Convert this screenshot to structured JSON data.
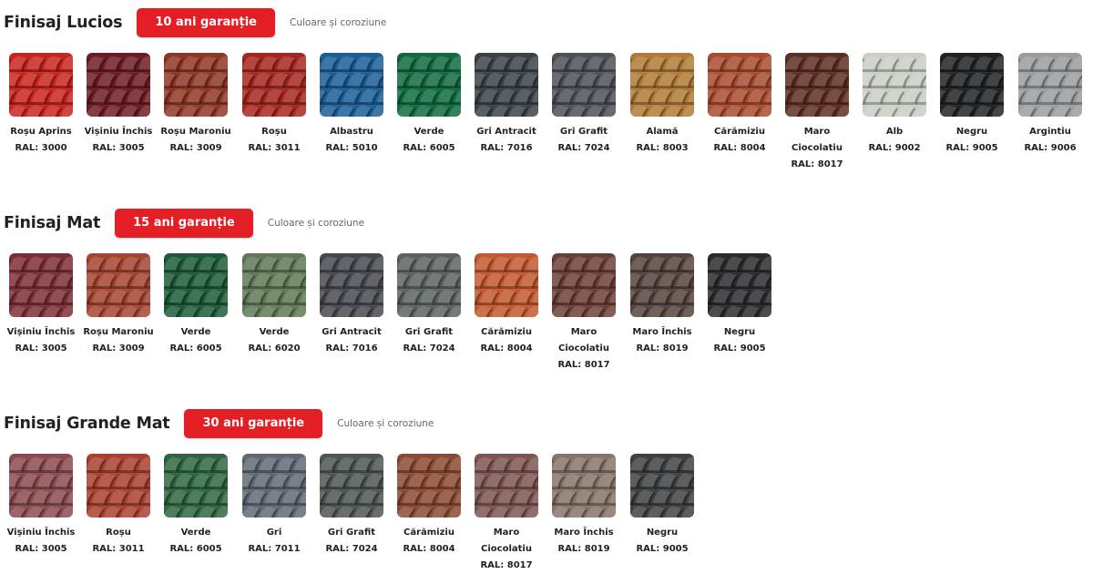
{
  "sections": [
    {
      "title": "Finisaj Lucios",
      "badge": "10 ani garanție",
      "subtitle": "Culoare și coroziune",
      "colors": [
        {
          "name": "Roșu Aprins",
          "ral": "RAL: 3000",
          "hex": "#c8231e",
          "icon": "roof-tile-swatch"
        },
        {
          "name": "Vișiniu Închis",
          "ral": "RAL: 3005",
          "hex": "#6d1a24",
          "icon": "roof-tile-swatch"
        },
        {
          "name": "Roșu Maroniu",
          "ral": "RAL: 3009",
          "hex": "#8e3524",
          "icon": "roof-tile-swatch"
        },
        {
          "name": "Roșu",
          "ral": "RAL: 3011",
          "hex": "#a5261e",
          "icon": "roof-tile-swatch"
        },
        {
          "name": "Albastru",
          "ral": "RAL: 5010",
          "hex": "#1b5d96",
          "icon": "roof-tile-swatch"
        },
        {
          "name": "Verde",
          "ral": "RAL: 6005",
          "hex": "#0f6a40",
          "icon": "roof-tile-swatch"
        },
        {
          "name": "Gri Antracit",
          "ral": "RAL: 7016",
          "hex": "#3b4146",
          "icon": "roof-tile-swatch"
        },
        {
          "name": "Gri Grafit",
          "ral": "RAL: 7024",
          "hex": "#4d5155",
          "icon": "roof-tile-swatch"
        },
        {
          "name": "Alamă",
          "ral": "RAL: 8003",
          "hex": "#b07a36",
          "icon": "roof-tile-swatch"
        },
        {
          "name": "Cărămiziu",
          "ral": "RAL: 8004",
          "hex": "#a84b2e",
          "icon": "roof-tile-swatch"
        },
        {
          "name": "Maro Ciocolatiu",
          "ral": "RAL: 8017",
          "hex": "#5c2d22",
          "icon": "roof-tile-swatch"
        },
        {
          "name": "Alb",
          "ral": "RAL: 9002",
          "hex": "#c9cdc6",
          "icon": "roof-tile-swatch"
        },
        {
          "name": "Negru",
          "ral": "RAL: 9005",
          "hex": "#202224",
          "icon": "roof-tile-swatch"
        },
        {
          "name": "Argintiu",
          "ral": "RAL: 9006",
          "hex": "#9a9c9e",
          "icon": "roof-tile-swatch"
        }
      ]
    },
    {
      "title": "Finisaj Mat",
      "badge": "15 ani garanție",
      "subtitle": "Culoare și coroziune",
      "colors": [
        {
          "name": "Vișiniu Închis",
          "ral": "RAL: 3005",
          "hex": "#7a2f35",
          "icon": "roof-tile-swatch"
        },
        {
          "name": "Roșu Maroniu",
          "ral": "RAL: 3009",
          "hex": "#a44431",
          "icon": "roof-tile-swatch"
        },
        {
          "name": "Verde",
          "ral": "RAL: 6005",
          "hex": "#1d5a37",
          "icon": "roof-tile-swatch"
        },
        {
          "name": "Verde",
          "ral": "RAL: 6020",
          "hex": "#5f7856",
          "icon": "roof-tile-swatch"
        },
        {
          "name": "Gri Antracit",
          "ral": "RAL: 7016",
          "hex": "#45494f",
          "icon": "roof-tile-swatch"
        },
        {
          "name": "Gri Grafit",
          "ral": "RAL: 7024",
          "hex": "#5d6261",
          "icon": "roof-tile-swatch"
        },
        {
          "name": "Cărămiziu",
          "ral": "RAL: 8004",
          "hex": "#c2582f",
          "icon": "roof-tile-swatch"
        },
        {
          "name": "Maro Ciocolatiu",
          "ral": "RAL: 8017",
          "hex": "#6b3e35",
          "icon": "roof-tile-swatch"
        },
        {
          "name": "Maro Închis",
          "ral": "RAL: 8019",
          "hex": "#55433d",
          "icon": "roof-tile-swatch"
        },
        {
          "name": "Negru",
          "ral": "RAL: 9005",
          "hex": "#2a2b2d",
          "icon": "roof-tile-swatch"
        }
      ]
    },
    {
      "title": "Finisaj Grande Mat",
      "badge": "30 ani garanție",
      "subtitle": "Culoare și coroziune",
      "colors": [
        {
          "name": "Vișiniu Închis",
          "ral": "RAL: 3005",
          "hex": "#8a4a4f",
          "icon": "roof-tile-swatch"
        },
        {
          "name": "Roșu",
          "ral": "RAL: 3011",
          "hex": "#a8402f",
          "icon": "roof-tile-swatch"
        },
        {
          "name": "Verde",
          "ral": "RAL: 6005",
          "hex": "#2e6540",
          "icon": "roof-tile-swatch"
        },
        {
          "name": "Gri",
          "ral": "RAL: 7011",
          "hex": "#5f6872",
          "icon": "roof-tile-swatch"
        },
        {
          "name": "Gri Grafit",
          "ral": "RAL: 7024",
          "hex": "#4e5552",
          "icon": "roof-tile-swatch"
        },
        {
          "name": "Cărămiziu",
          "ral": "RAL: 8004",
          "hex": "#8a4a33",
          "icon": "roof-tile-swatch"
        },
        {
          "name": "Maro Ciocolatiu",
          "ral": "RAL: 8017",
          "hex": "#7d5550",
          "icon": "roof-tile-swatch"
        },
        {
          "name": "Maro Închis",
          "ral": "RAL: 8019",
          "hex": "#86746a",
          "icon": "roof-tile-swatch"
        },
        {
          "name": "Negru",
          "ral": "RAL: 9005",
          "hex": "#3e4042",
          "icon": "roof-tile-swatch"
        }
      ]
    }
  ]
}
